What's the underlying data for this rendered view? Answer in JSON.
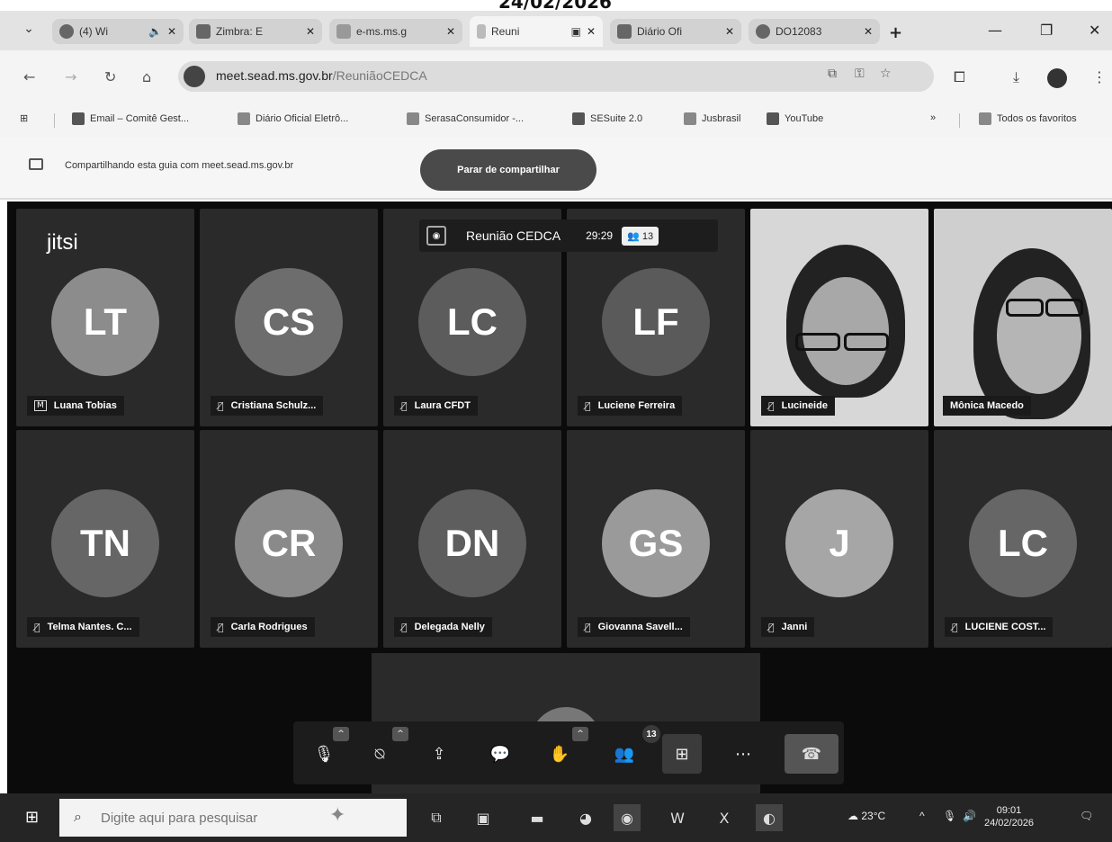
{
  "header": {
    "date": "24/02/2026"
  },
  "tabs": [
    {
      "label": "(4) Wi",
      "extra": "🔈",
      "icon": "whatsapp-icon",
      "active": false
    },
    {
      "label": "Zimbra: E",
      "icon": "zimbra-icon",
      "active": false
    },
    {
      "label": "e-ms.ms.g",
      "icon": "doc-icon",
      "active": false
    },
    {
      "label": "Reuni",
      "extra": "▣",
      "icon": "jitsi-icon",
      "active": true
    },
    {
      "label": "Diário Ofi",
      "icon": "newspaper-icon",
      "active": false
    },
    {
      "label": "DO12083",
      "icon": "globe-icon",
      "active": false
    }
  ],
  "address_bar": {
    "url_host": "meet.sead.ms.gov.br",
    "url_path": "/ReuniãoCEDCA"
  },
  "bookmarks": [
    {
      "label": "Email – Comitê Gest..."
    },
    {
      "label": "Diário Oficial Eletrô..."
    },
    {
      "label": "SerasaConsumidor -..."
    },
    {
      "label": "SESuite 2.0"
    },
    {
      "label": "Jusbrasil"
    },
    {
      "label": "YouTube"
    }
  ],
  "bookmarks_overflow": "»",
  "bookmarks_all": "Todos os favoritos",
  "share_bar": {
    "text": "Compartilhando esta guia com meet.sead.ms.gov.br",
    "stop_label": "Parar de compartilhar"
  },
  "meeting": {
    "logo": "jitsi",
    "title": "Reunião CEDCA",
    "timer": "29:29",
    "participant_count": "13",
    "participants": [
      {
        "initials": "LT",
        "name": "Luana Tobias",
        "color": "#8c8c8c",
        "badge": "M"
      },
      {
        "initials": "CS",
        "name": "Cristiana Schulz...",
        "color": "#6d6d6d"
      },
      {
        "initials": "LC",
        "name": "Laura CFDT",
        "color": "#5c5c5c"
      },
      {
        "initials": "LF",
        "name": "Luciene Ferreira",
        "color": "#5a5a5a"
      },
      {
        "initials": "",
        "name": "Lucineide",
        "video": true
      },
      {
        "initials": "",
        "name": "Mônica Macedo",
        "video": true
      },
      {
        "initials": "TN",
        "name": "Telma Nantes. C...",
        "color": "#666666"
      },
      {
        "initials": "CR",
        "name": "Carla Rodrigues",
        "color": "#8a8a8a"
      },
      {
        "initials": "DN",
        "name": "Delegada Nelly",
        "color": "#5e5e5e"
      },
      {
        "initials": "GS",
        "name": "Giovanna Savell...",
        "color": "#9a9a9a"
      },
      {
        "initials": "J",
        "name": "Janni",
        "color": "#a6a6a6"
      },
      {
        "initials": "LC",
        "name": "LUCIENE COST...",
        "color": "#666666"
      }
    ],
    "toolbar_badge": "13"
  },
  "taskbar": {
    "search_placeholder": "Digite aqui para pesquisar",
    "weather": "23°C",
    "time": "09:01",
    "date": "24/02/2026"
  }
}
